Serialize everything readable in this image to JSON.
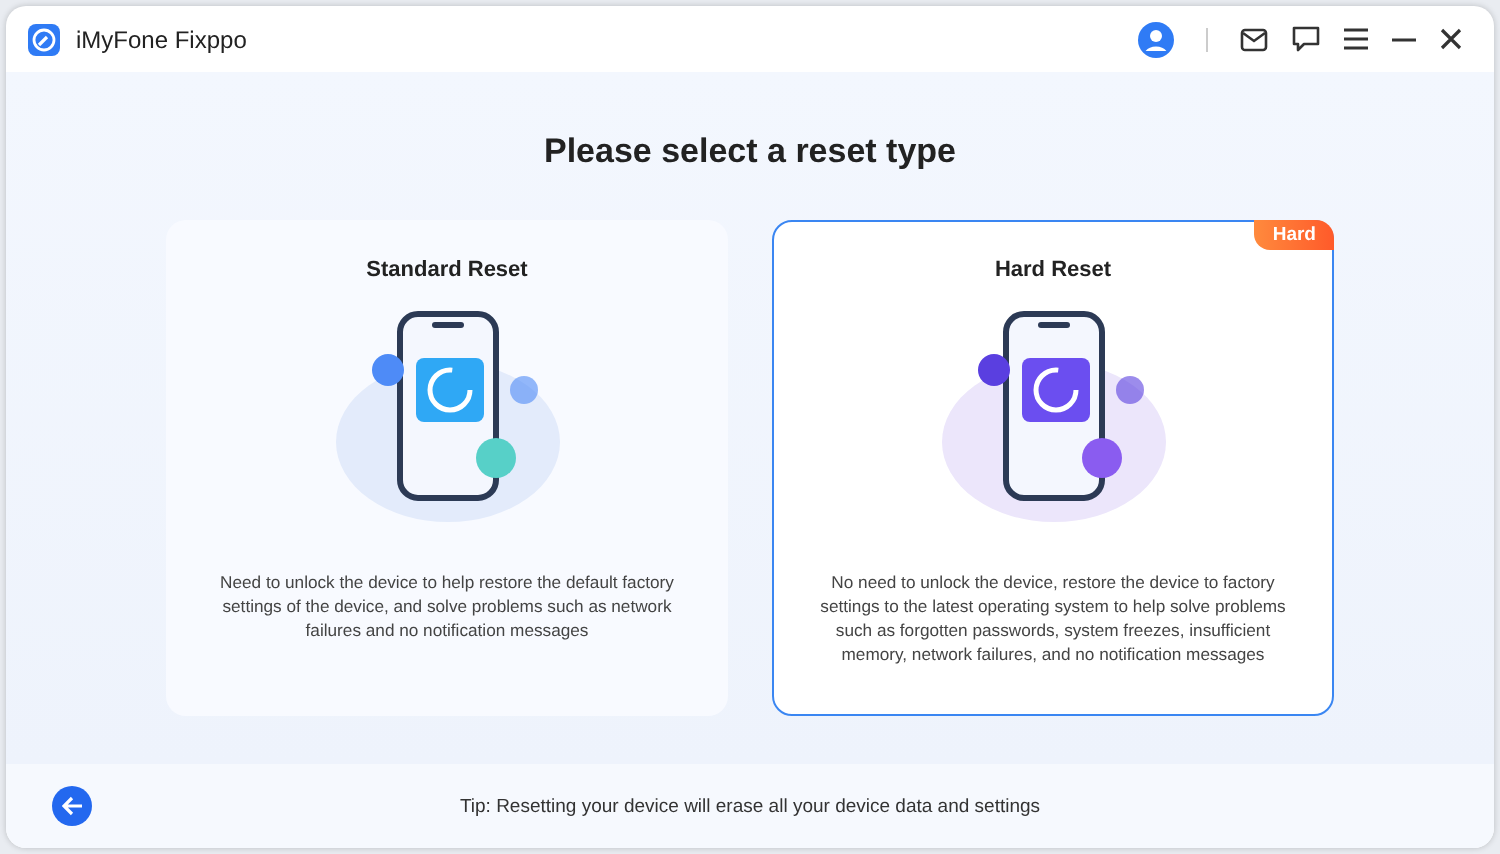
{
  "window": {
    "title": "iMyFone Fixppo"
  },
  "heading": "Please select a reset type",
  "options": [
    {
      "kind": "standard",
      "title": "Standard Reset",
      "selected": false,
      "description": "Need to unlock the device to help restore the default factory settings of the device, and solve problems such as network failures and no notification messages"
    },
    {
      "kind": "hard",
      "title": "Hard Reset",
      "selected": true,
      "badge": "Hard",
      "description": "No need to unlock the device, restore the device to factory settings to the latest operating system to help solve problems such as forgotten passwords, system freezes, insufficient memory, network failures, and no notification messages"
    }
  ],
  "tip": "Tip: Resetting your device will erase all your device data and settings"
}
